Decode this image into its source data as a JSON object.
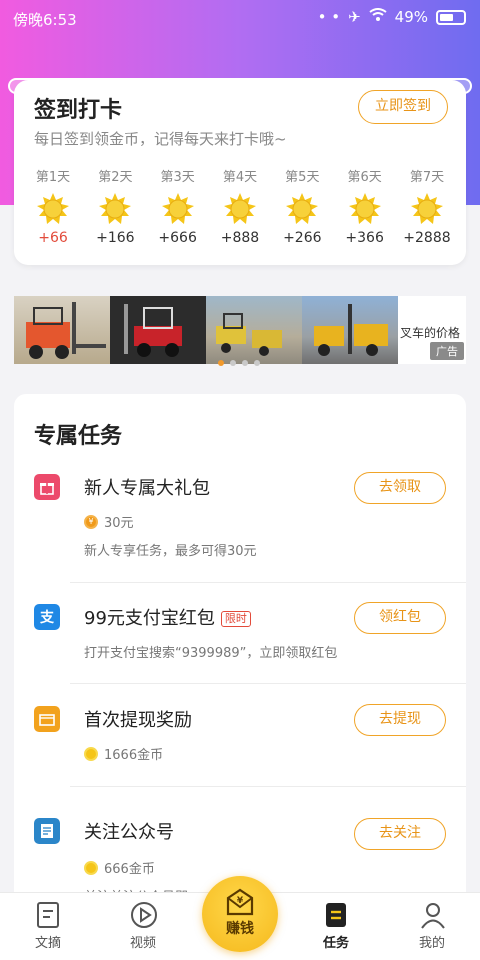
{
  "status_bar": {
    "time": "傍晚6:53",
    "battery": "49%"
  },
  "signin": {
    "title": "签到打卡",
    "subtitle": "每日签到领金币，记得每天来打卡哦~",
    "button": "立即签到",
    "days": [
      {
        "label": "第1天",
        "reward": "+66"
      },
      {
        "label": "第2天",
        "reward": "+166"
      },
      {
        "label": "第3天",
        "reward": "+666"
      },
      {
        "label": "第4天",
        "reward": "+888"
      },
      {
        "label": "第5天",
        "reward": "+266"
      },
      {
        "label": "第6天",
        "reward": "+366"
      },
      {
        "label": "第7天",
        "reward": "+2888"
      }
    ]
  },
  "ad": {
    "text": "叉车的价格",
    "tag": "广告"
  },
  "tasks": {
    "header": "专属任务",
    "items": [
      {
        "title": "新人专属大礼包",
        "reward": "30元",
        "desc": "新人专享任务，最多可得30元",
        "button": "去领取",
        "icon": "gift-icon"
      },
      {
        "title": "99元支付宝红包",
        "tag": "限时",
        "desc": "打开支付宝搜索“9399989”，立即领取红包",
        "button": "领红包",
        "icon": "alipay-icon"
      },
      {
        "title": "首次提现奖励",
        "reward": "1666金币",
        "button": "去提现",
        "icon": "wallet-icon"
      },
      {
        "title": "关注公众号",
        "reward": "666金币",
        "desc": "关注关注公众号即",
        "button": "去关注",
        "icon": "document-icon"
      }
    ]
  },
  "tab_bar": {
    "items": [
      {
        "label": "文摘",
        "icon": "article-icon"
      },
      {
        "label": "视频",
        "icon": "play-icon"
      },
      {
        "label": "赚钱",
        "icon": "earn-icon"
      },
      {
        "label": "任务",
        "icon": "task-icon"
      },
      {
        "label": "我的",
        "icon": "user-icon"
      }
    ],
    "active": "任务"
  },
  "colors": {
    "accent": "#f0a428",
    "highlight": "#e24b3b",
    "gradient_start": "#f15be0",
    "gradient_end": "#6f6cf0"
  }
}
